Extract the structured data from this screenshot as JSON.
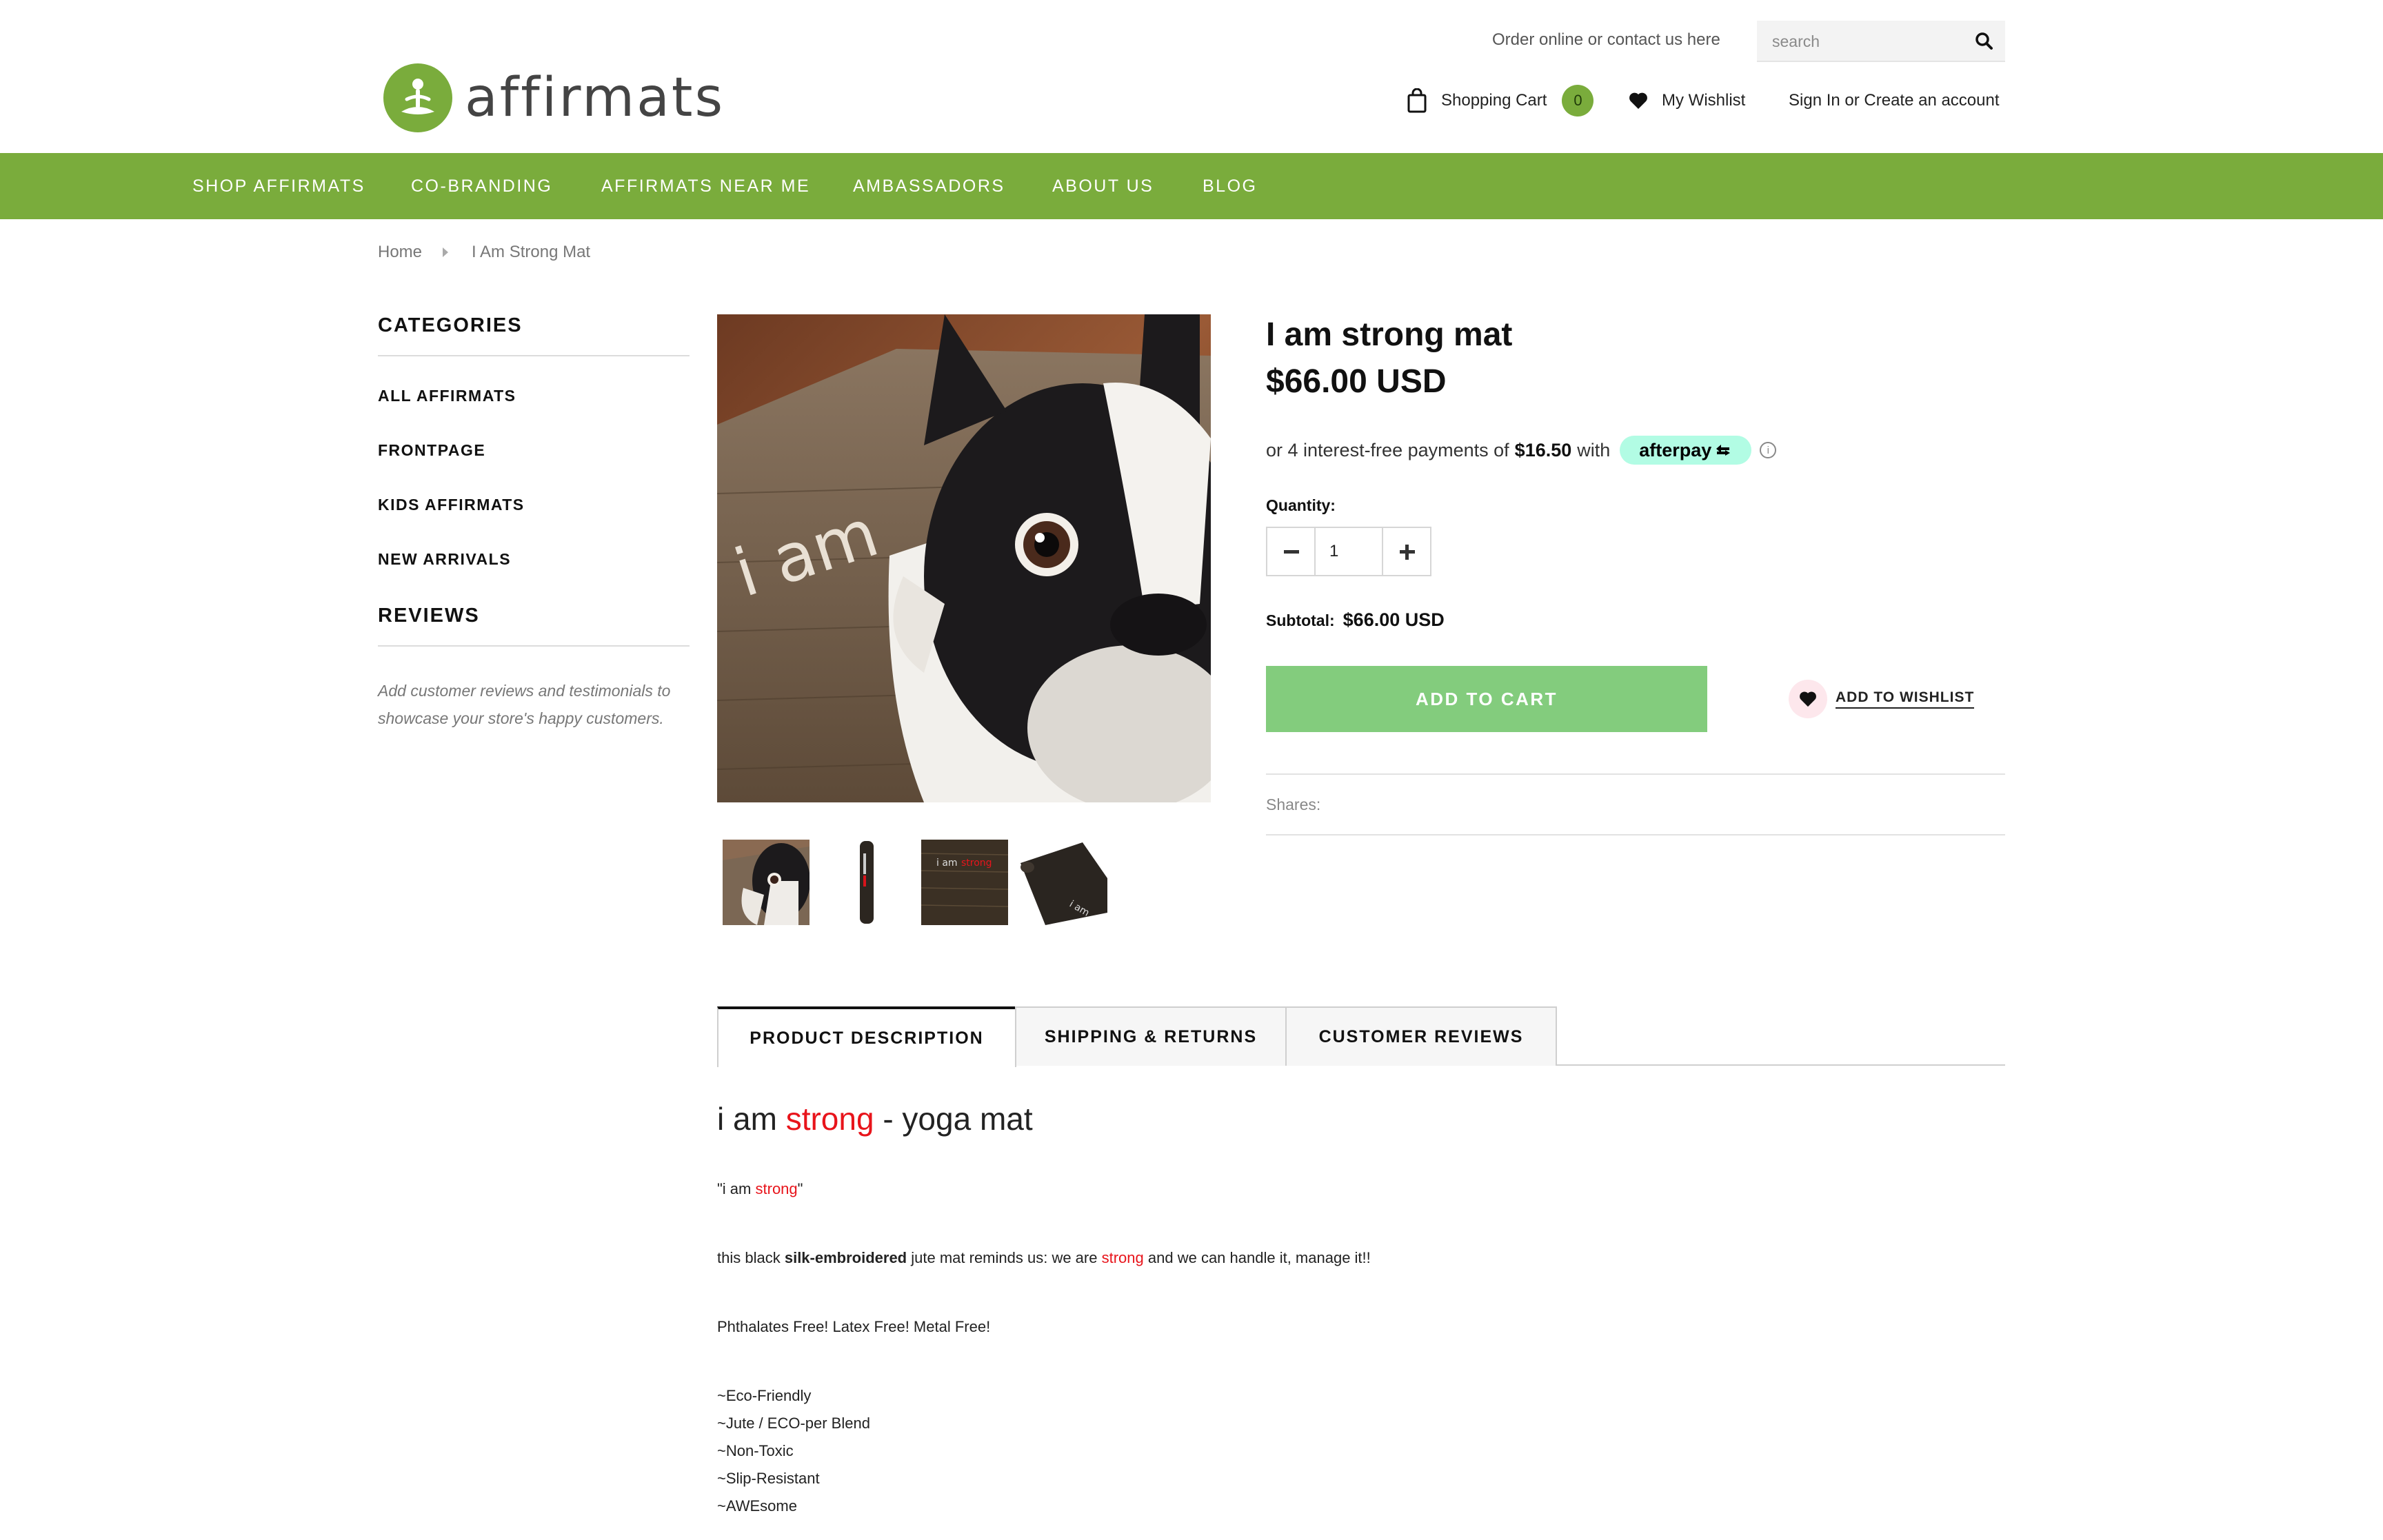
{
  "header": {
    "logo_text": "affirmats",
    "order_link": "Order online or contact us here",
    "search_placeholder": "search",
    "cart_label": "Shopping Cart",
    "cart_count": "0",
    "wishlist_label": "My Wishlist",
    "signin_label": "Sign In or Create an account"
  },
  "colors": {
    "brand_green": "#7aac3c",
    "add_to_cart": "#83cc7d",
    "afterpay": "#b2fce4",
    "accent_red": "#e8141b"
  },
  "nav": {
    "items": [
      "SHOP AFFIRMATS",
      "CO-BRANDING",
      "AFFIRMATS NEAR ME",
      "AMBASSADORS",
      "ABOUT US",
      "BLOG"
    ]
  },
  "breadcrumb": {
    "home": "Home",
    "current": "I Am Strong Mat"
  },
  "sidebar": {
    "categories_heading": "CATEGORIES",
    "categories": [
      "ALL AFFIRMATS",
      "FRONTPAGE",
      "KIDS AFFIRMATS",
      "NEW ARRIVALS"
    ],
    "reviews_heading": "REVIEWS",
    "reviews_note": "Add customer reviews and testimonials to showcase your store's happy customers."
  },
  "product": {
    "title": "I am strong mat",
    "price": "$66.00 USD",
    "afterpay_prefix": "or 4 interest-free payments of",
    "afterpay_amount": "$16.50",
    "afterpay_with": "with",
    "afterpay_brand": "afterpay",
    "info_glyph": "i",
    "quantity_label": "Quantity:",
    "quantity_value": "1",
    "subtotal_label": "Subtotal:",
    "subtotal_value": "$66.00 USD",
    "add_to_cart": "ADD TO CART",
    "add_to_wishlist": "ADD TO WISHLIST",
    "shares_label": "Shares:",
    "mat_print": "i am",
    "thumb_mat_print": "i am",
    "thumb_mat_print_red": "strong"
  },
  "tabs": [
    "PRODUCT DESCRIPTION",
    "SHIPPING & RETURNS",
    "CUSTOMER REVIEWS"
  ],
  "description": {
    "heading_pre": "i am",
    "heading_red": "strong",
    "heading_post": "- yoga mat",
    "quote_pre": "\"i am",
    "quote_red": "strong",
    "quote_post": "\"",
    "line2_pre": "this black",
    "line2_bold": "silk-embroidered",
    "line2_mid": "jute mat reminds us: we are",
    "line2_red": "strong",
    "line2_post": "and we can handle it, manage it!!",
    "line3": "Phthalates Free! Latex Free! Metal Free!",
    "features": [
      "~Eco-Friendly",
      "~Jute / ECO-per Blend",
      "~Non-Toxic",
      "~Slip-Resistant",
      "~AWEsome"
    ]
  }
}
